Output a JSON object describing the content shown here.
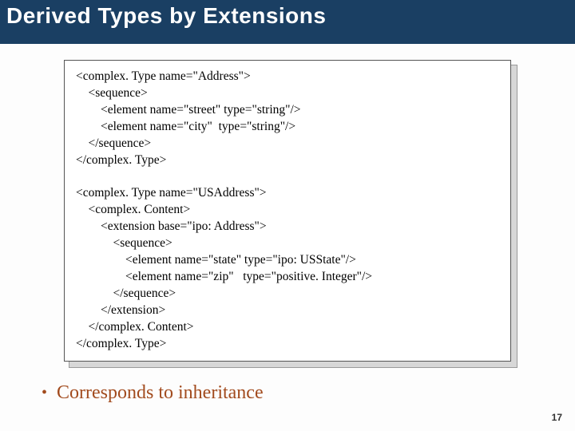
{
  "title": "Derived Types by Extensions",
  "code": {
    "l1": "<complex. Type name=\"Address\">",
    "l2": "    <sequence>",
    "l3": "        <element name=\"street\" type=\"string\"/>",
    "l4": "        <element name=\"city\"  type=\"string\"/>",
    "l5": "    </sequence>",
    "l6": "</complex. Type>",
    "l7": "",
    "l8": "<complex. Type name=\"USAddress\">",
    "l9": "    <complex. Content>",
    "l10": "        <extension base=\"ipo: Address\">",
    "l11": "            <sequence>",
    "l12": "                <element name=\"state\" type=\"ipo: USState\"/>",
    "l13": "                <element name=\"zip\"   type=\"positive. Integer\"/>",
    "l14": "            </sequence>",
    "l15": "        </extension>",
    "l16": "    </complex. Content>",
    "l17": "</complex. Type>"
  },
  "bullet_text": "Corresponds to inheritance",
  "page_number": "17"
}
